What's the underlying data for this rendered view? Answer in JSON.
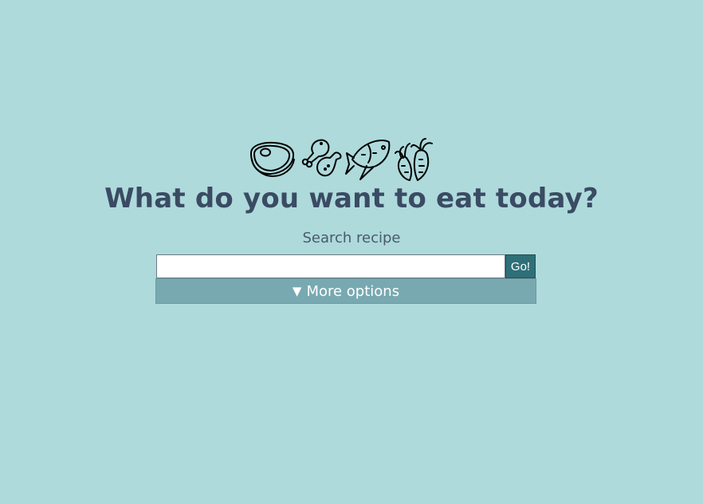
{
  "header": {
    "icons": [
      "steak-icon",
      "chicken-leg-icon",
      "fish-icon",
      "carrot-icon"
    ],
    "title": "What do you want to eat today?"
  },
  "search": {
    "label": "Search recipe",
    "value": "",
    "placeholder": "",
    "go_label": "Go!"
  },
  "options": {
    "arrow": "▼",
    "label": "More options"
  },
  "colors": {
    "background": "#aedadc",
    "title": "#3a4b63",
    "go_button": "#2f6f78",
    "more_options_bar": "#78a9b1"
  }
}
